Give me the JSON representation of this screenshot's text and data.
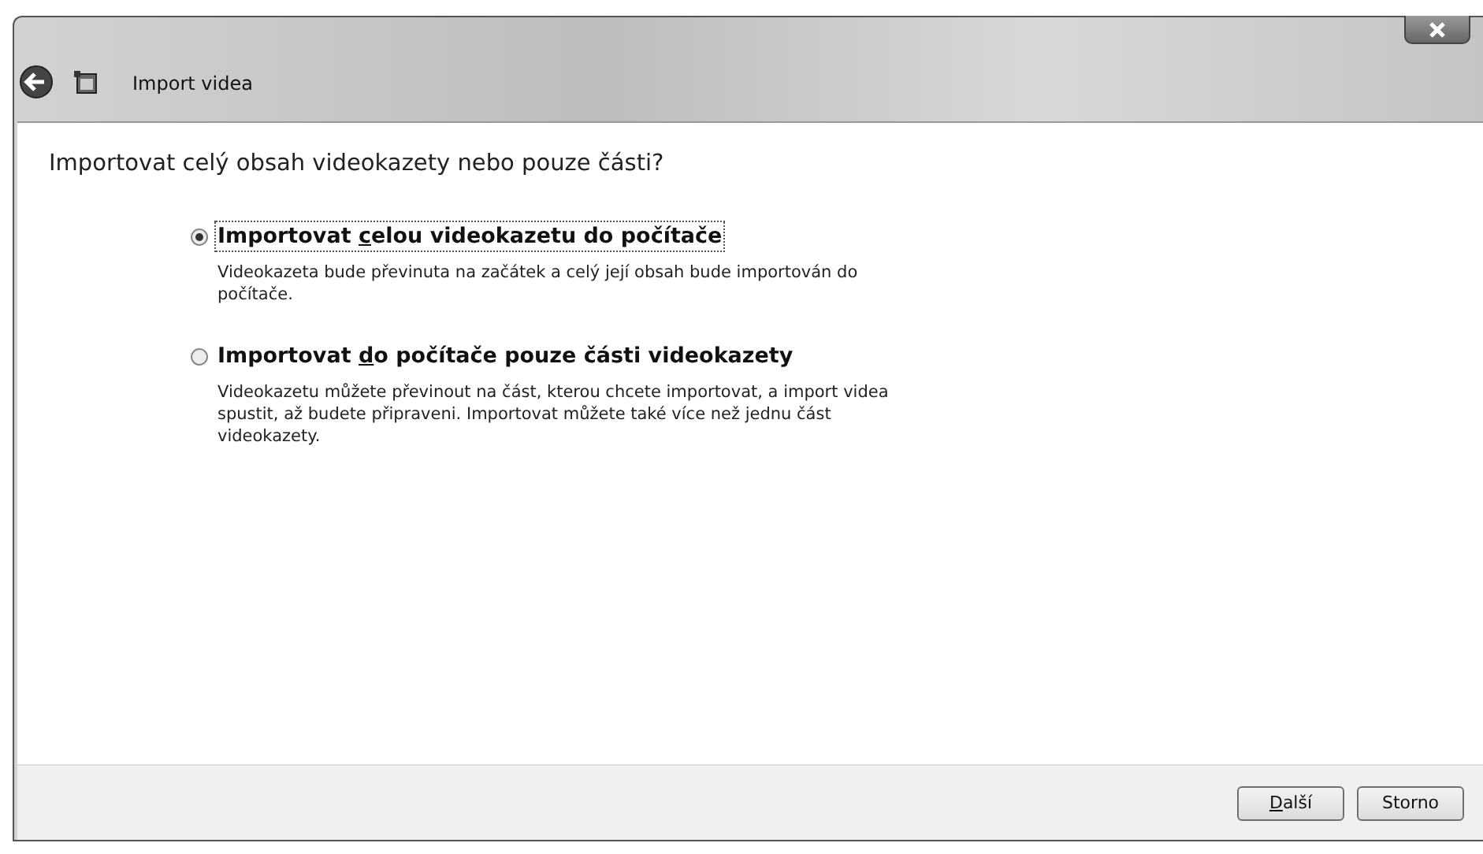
{
  "window": {
    "title": "Import videa"
  },
  "heading": "Importovat celý obsah videokazety nebo pouze části?",
  "options": [
    {
      "label_before": "Importovat ",
      "access_key": "c",
      "label_after": "elou videokazetu do počítače",
      "description": "Videokazeta bude převinuta na začátek a celý její obsah bude importován do počítače.",
      "selected": true
    },
    {
      "label_before": "Importovat ",
      "access_key": "d",
      "label_after": "o počítače pouze části videokazety",
      "description": "Videokazetu můžete převinout na část, kterou chcete importovat, a import videa spustit, až budete připraveni. Importovat můžete také více než jednu část videokazety.",
      "selected": false
    }
  ],
  "buttons": [
    {
      "access_key": "D",
      "label_after": "alší"
    },
    {
      "label_after": "Storno"
    }
  ]
}
